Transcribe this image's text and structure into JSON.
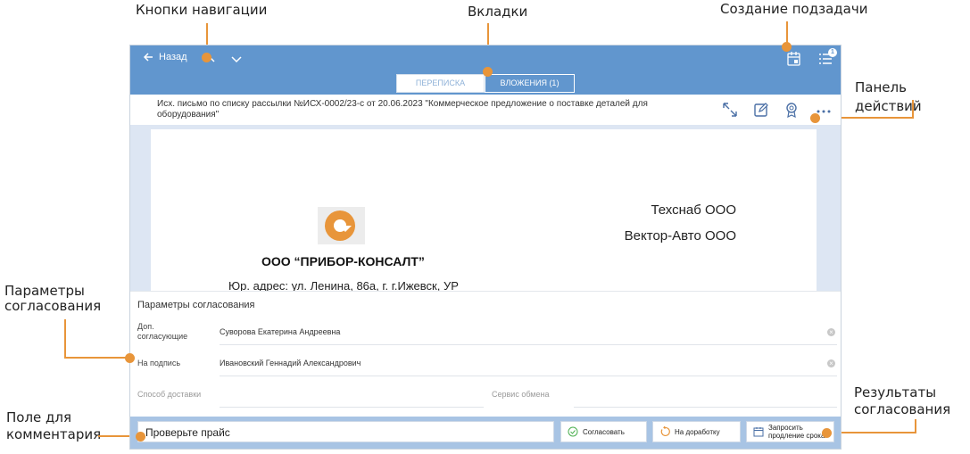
{
  "callouts": {
    "nav_buttons": "Кнопки навигации",
    "tabs": "Вкладки",
    "subtask": "Создание подзадачи",
    "action_panel": "Панель действий",
    "approval_params_1": "Параметры",
    "approval_params_2": "согласования",
    "comment_field_1": "Поле для",
    "comment_field_2": "комментария",
    "results_1": "Результаты",
    "results_2": "согласования"
  },
  "header": {
    "back_label": "Назад",
    "badge_count": "1",
    "tabs": [
      {
        "label": "ПЕРЕПИСКА",
        "active": false
      },
      {
        "label": "ВЛОЖЕНИЯ (1)",
        "active": true
      }
    ]
  },
  "document": {
    "title": "Исх. письмо по списку рассылки №ИСХ-0002/23-с от 20.06.2023 \"Коммерческое предложение о поставке деталей для оборудования\"",
    "recipient_1": "Техснаб ООО",
    "recipient_2": "Вектор-Авто ООО",
    "company": "ООО “ПРИБОР-КОНСАЛТ”",
    "address": "Юр. адрес: ул. Ленина, 86а, г. г.Ижевск, УР"
  },
  "params": {
    "title": "Параметры согласования",
    "extra_approvers_label_1": "Доп.",
    "extra_approvers_label_2": "согласующие",
    "extra_approvers_value": "Суворова Екатерина Андреевна",
    "signing_label": "На подпись",
    "signing_value": "Ивановский Геннадий Александрович",
    "delivery_placeholder": "Способ доставки",
    "exchange_placeholder": "Сервис обмена"
  },
  "bottom": {
    "comment_value": "Проверьте прайс",
    "approve_label": "Согласовать",
    "rework_label": "На доработку",
    "extend_label_1": "Запросить",
    "extend_label_2": "продление срока"
  },
  "colors": {
    "header_bg": "#6196ce",
    "accent": "#e8953a",
    "bottom_bg": "#a8c4e4",
    "approve_icon": "#4caf50",
    "rework_icon": "#e8953a"
  }
}
